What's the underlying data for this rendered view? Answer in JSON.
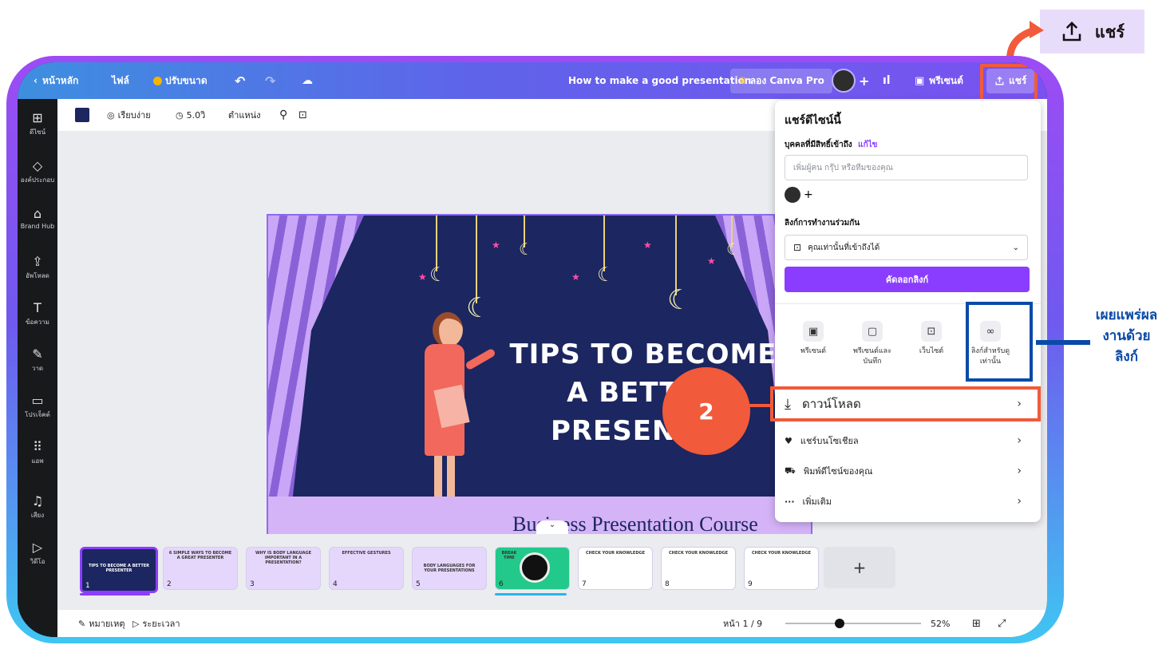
{
  "share_callout": {
    "label": "แชร์"
  },
  "topbar": {
    "home": "หน้าหลัก",
    "file": "ไฟล์",
    "resize": "ปรับขนาด",
    "title": "How to make a good presentation",
    "try_pro": "ลอง Canva Pro",
    "present": "พรีเซนต์",
    "share": "แชร์"
  },
  "sidebar": {
    "items": [
      {
        "label": "ดีไซน์",
        "icon": "design-icon"
      },
      {
        "label": "องค์ประกอบ",
        "icon": "elements-icon"
      },
      {
        "label": "Brand Hub",
        "icon": "brand-hub-icon"
      },
      {
        "label": "อัพโหลด",
        "icon": "upload-icon"
      },
      {
        "label": "ข้อความ",
        "icon": "text-icon"
      },
      {
        "label": "วาด",
        "icon": "draw-icon"
      },
      {
        "label": "โปรเจ็คต์",
        "icon": "projects-icon"
      },
      {
        "label": "แอพ",
        "icon": "apps-icon"
      },
      {
        "label": "เสียง",
        "icon": "audio-icon"
      },
      {
        "label": "วิดีโอ",
        "icon": "video-icon"
      }
    ]
  },
  "toolbar": {
    "animate": "เรียบง่าย",
    "duration": "5.0วิ",
    "position": "ตำแหน่ง"
  },
  "slide": {
    "title_line1": "TIPS TO BECOME",
    "title_line2": "A BETTER PRESENTER",
    "subtitle": "Business Presentation Course"
  },
  "share_panel": {
    "heading": "แชร์ดีไซน์นี้",
    "access_label": "บุคคลที่มีสิทธิ์เข้าถึง",
    "access_edit": "แก้ไข",
    "add_people_placeholder": "เพิ่มผู้คน กรุ๊ป หรือทีมของคุณ",
    "collab_label": "ลิงก์การทำงานร่วมกัน",
    "access_option": "คุณเท่านั้นที่เข้าถึงได้",
    "copy_link": "คัดลอกลิงก์",
    "options": [
      {
        "label": "พรีเซนต์",
        "icon": "present-icon"
      },
      {
        "label": "พรีเซนต์และบันทึก",
        "icon": "record-icon"
      },
      {
        "label": "เว็บไซต์",
        "icon": "website-icon"
      },
      {
        "label": "ลิงก์สำหรับดูเท่านั้น",
        "icon": "link-icon"
      }
    ],
    "download": "ดาวน์โหลด",
    "social": "แชร์บนโซเชียล",
    "print": "พิมพ์ดีไซน์ของคุณ",
    "more": "เพิ่มเติม"
  },
  "annotations": {
    "step_number": "2",
    "link_note_line1": "เผยแพร่ผล",
    "link_note_line2": "งานด้วย",
    "link_note_line3": "ลิงก์"
  },
  "filmstrip": {
    "thumbs": [
      {
        "num": "1",
        "title": "TIPS TO BECOME A BETTER PRESENTER"
      },
      {
        "num": "2",
        "title": "6 SIMPLE WAYS TO BECOME A GREAT PRESENTER"
      },
      {
        "num": "3",
        "title": "WHY IS BODY LANGUAGE IMPORTANT IN A PRESENTATION?"
      },
      {
        "num": "4",
        "title": "EFFECTIVE GESTURES"
      },
      {
        "num": "5",
        "title": "BODY LANGUAGES FOR YOUR PRESENTATIONS"
      },
      {
        "num": "6",
        "title": "BREAK TIME"
      },
      {
        "num": "7",
        "title": "CHECK YOUR KNOWLEDGE"
      },
      {
        "num": "8",
        "title": "CHECK YOUR KNOWLEDGE"
      },
      {
        "num": "9",
        "title": "CHECK YOUR KNOWLEDGE"
      }
    ]
  },
  "bottombar": {
    "notes": "หมายเหตุ",
    "timer": "ระยะเวลา",
    "page": "หน้า 1 / 9",
    "zoom": "52%",
    "zoom_level": 0.52
  },
  "colors": {
    "accent": "#8b3dff",
    "callout": "#f15a3a",
    "highlight_blue": "#0a4aa8"
  }
}
